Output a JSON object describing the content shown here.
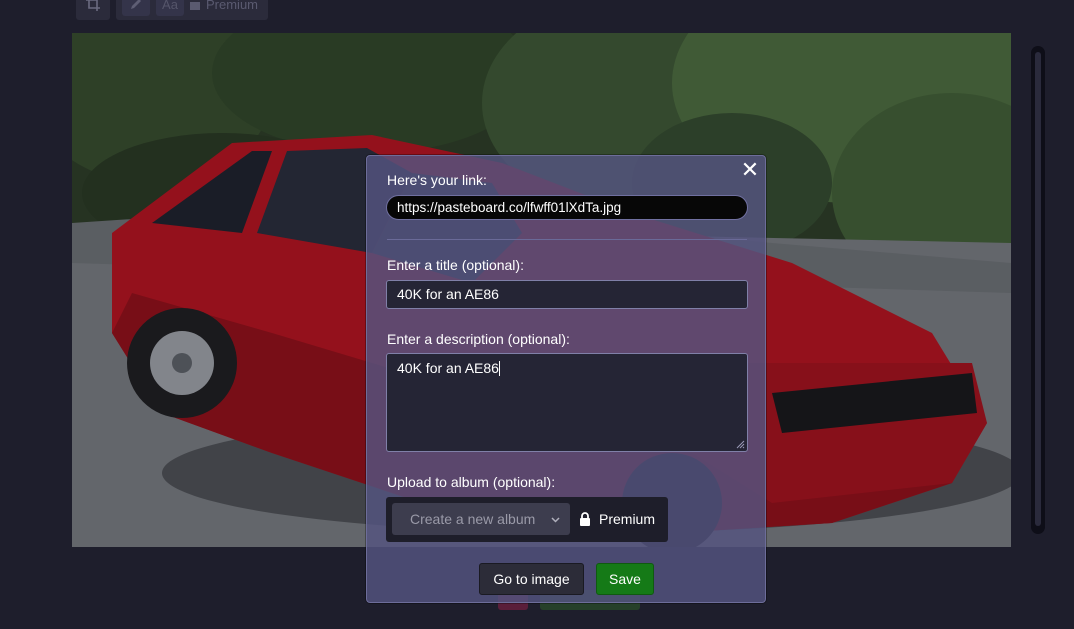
{
  "toolbar": {
    "text_tool_label": "Aa",
    "premium_label": "Premium"
  },
  "modal": {
    "link_label": "Here's your link:",
    "link_value": "https://pasteboard.co/lfwff01lXdTa.jpg",
    "title_label": "Enter a title (optional):",
    "title_value": "40K for an AE86",
    "description_label": "Enter a description (optional):",
    "description_value": "40K for an AE86",
    "album_label": "Upload to album (optional):",
    "album_placeholder": "Create a new album",
    "premium_label": "Premium",
    "go_to_image_label": "Go to image",
    "save_label": "Save"
  },
  "colors": {
    "save_button": "#157a17",
    "modal_bg": "#545480",
    "car_body": "#c0121c"
  },
  "icons": {
    "close": "close-icon",
    "crop": "crop-icon",
    "pencil": "pencil-icon",
    "lock": "lock-icon",
    "chevron": "chevron-down-icon"
  }
}
